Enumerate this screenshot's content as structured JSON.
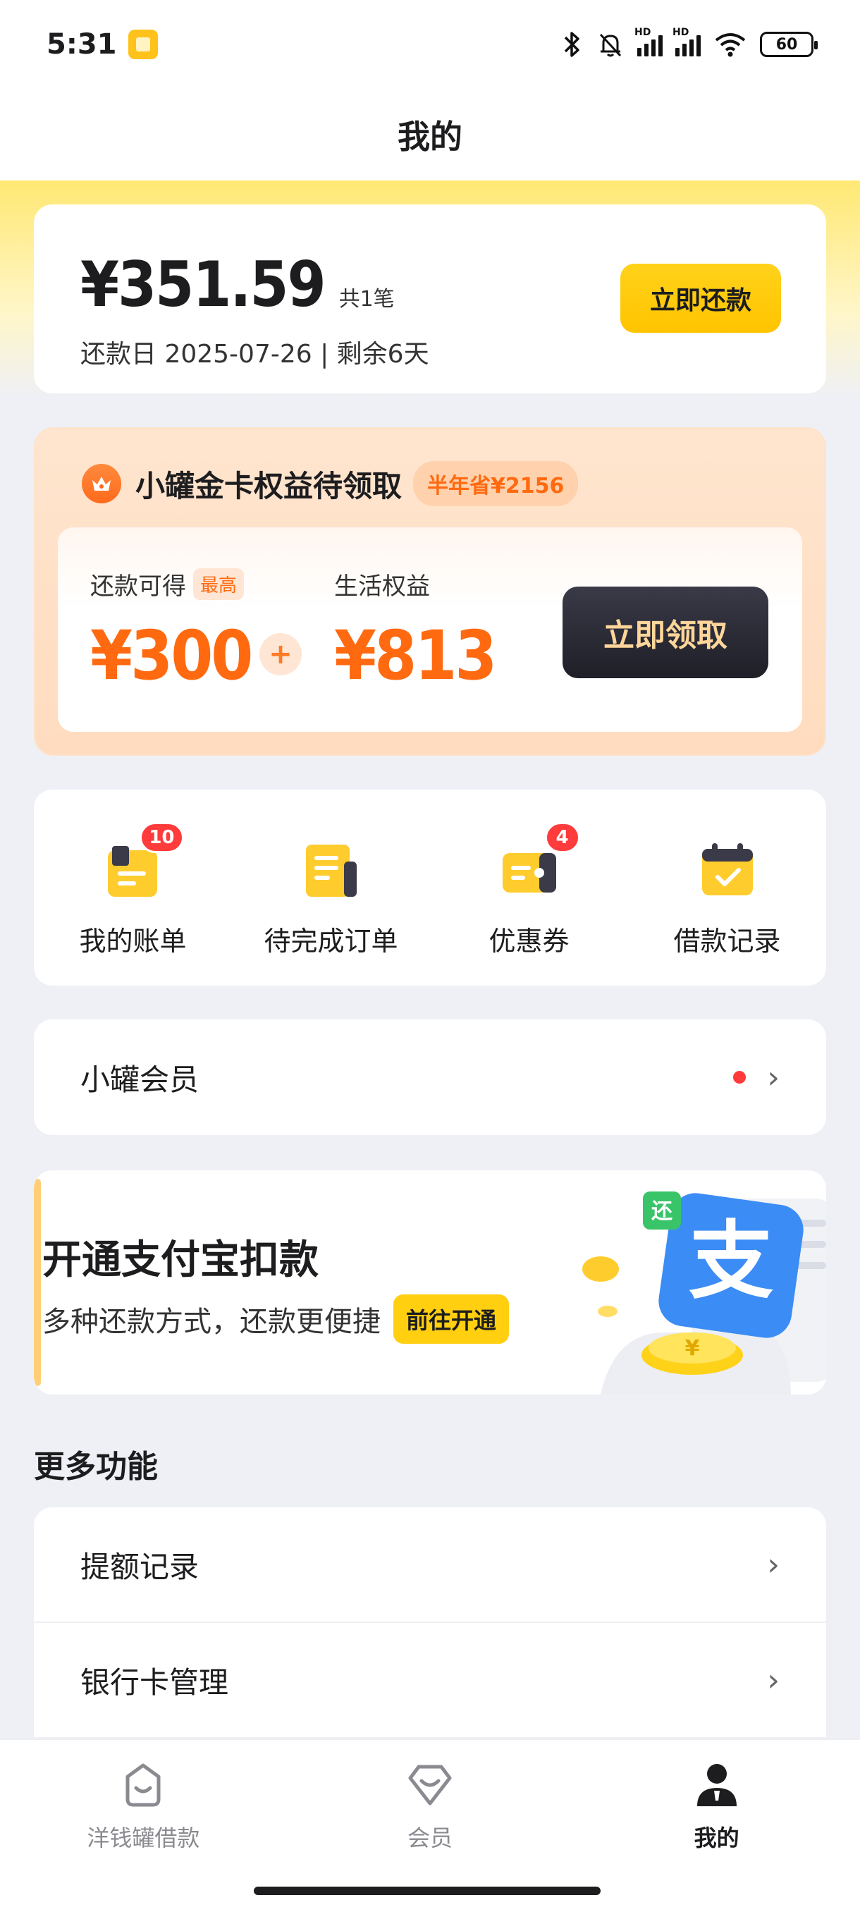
{
  "status_bar": {
    "time": "5:31",
    "battery": "60",
    "network": "HD"
  },
  "header": {
    "title": "我的"
  },
  "repay_card": {
    "amount": "¥351.59",
    "count": "共1笔",
    "due_text": "还款日 2025-07-26 | 剩余6天",
    "button": "立即还款"
  },
  "gold_card": {
    "title": "小罐金卡权益待领取",
    "badge": "半年省¥2156",
    "left_label": "还款可得",
    "left_tag": "最高",
    "left_value": "¥300",
    "plus": "+",
    "right_label": "生活权益",
    "right_value": "¥813",
    "button": "立即领取"
  },
  "quick_actions": [
    {
      "label": "我的账单",
      "icon": "bill-icon",
      "badge": "10"
    },
    {
      "label": "待完成订单",
      "icon": "order-icon",
      "badge": ""
    },
    {
      "label": "优惠券",
      "icon": "coupon-icon",
      "badge": "4"
    },
    {
      "label": "借款记录",
      "icon": "calendar-icon",
      "badge": ""
    }
  ],
  "member_row": {
    "label": "小罐会员"
  },
  "alipay_banner": {
    "title": "开通支付宝扣款",
    "subtitle": "多种还款方式，还款更便捷",
    "button": "前往开通",
    "logo_text": "支",
    "logo_tag": "还",
    "coin_text": "¥"
  },
  "more_section": {
    "title": "更多功能",
    "items": [
      {
        "label": "提额记录"
      },
      {
        "label": "银行卡管理"
      }
    ]
  },
  "tabbar": {
    "tabs": [
      {
        "label": "洋钱罐借款",
        "icon": "jar-icon"
      },
      {
        "label": "会员",
        "icon": "member-icon"
      },
      {
        "label": "我的",
        "icon": "profile-icon"
      }
    ]
  },
  "colors": {
    "brand_yellow": "#ffc400",
    "accent_orange": "#ff6a10",
    "dark_button": "#1f1f28",
    "badge_red": "#ff3b3b"
  }
}
